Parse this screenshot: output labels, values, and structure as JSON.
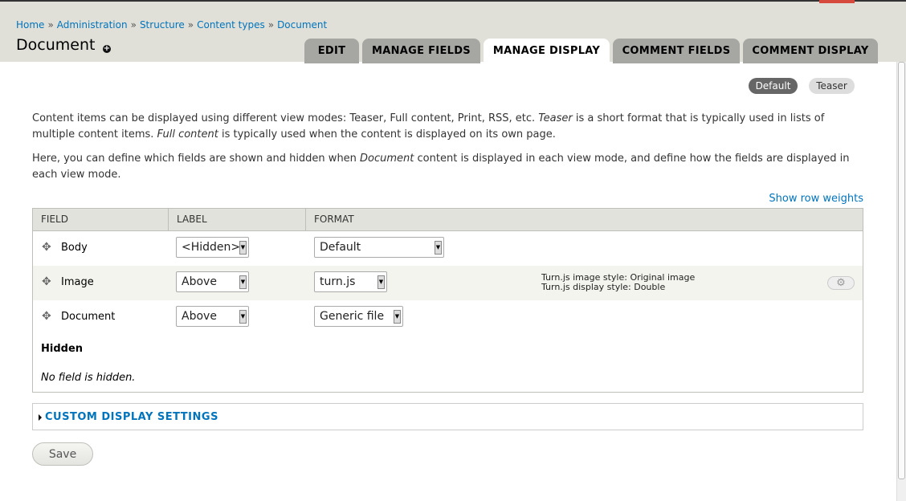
{
  "breadcrumb": [
    "Home",
    "Administration",
    "Structure",
    "Content types",
    "Document"
  ],
  "breadcrumb_sep": "»",
  "page_title": "Document",
  "tabs": [
    "EDIT",
    "MANAGE FIELDS",
    "MANAGE DISPLAY",
    "COMMENT FIELDS",
    "COMMENT DISPLAY"
  ],
  "active_tab": "MANAGE DISPLAY",
  "view_modes": {
    "default": "Default",
    "teaser": "Teaser"
  },
  "description": {
    "p1_a": "Content items can be displayed using different view modes: Teaser, Full content, Print, RSS, etc. ",
    "p1_b": "Teaser",
    "p1_c": " is a short format that is typically used in lists of multiple content items. ",
    "p1_d": "Full content",
    "p1_e": " is typically used when the content is displayed on its own page.",
    "p2_a": "Here, you can define which fields are shown and hidden when ",
    "p2_b": "Document",
    "p2_c": " content is displayed in each view mode, and define how the fields are displayed in each view mode."
  },
  "show_row_weights": "Show row weights",
  "table": {
    "headers": {
      "field": "FIELD",
      "label": "LABEL",
      "format": "FORMAT"
    },
    "rows": [
      {
        "field": "Body",
        "label": "<Hidden>",
        "format": "Default"
      },
      {
        "field": "Image",
        "label": "Above",
        "format": "turn.js",
        "summary1": "Turn.js image style: Original image",
        "summary2": "Turn.js display style: Double"
      },
      {
        "field": "Document",
        "label": "Above",
        "format": "Generic file"
      }
    ],
    "hidden_title": "Hidden",
    "hidden_empty": "No field is hidden."
  },
  "custom_display": "CUSTOM DISPLAY SETTINGS",
  "save_label": "Save",
  "icons": {
    "drag": "move-icon",
    "gear": "gear-icon",
    "shortcut": "plus-circle-icon"
  }
}
